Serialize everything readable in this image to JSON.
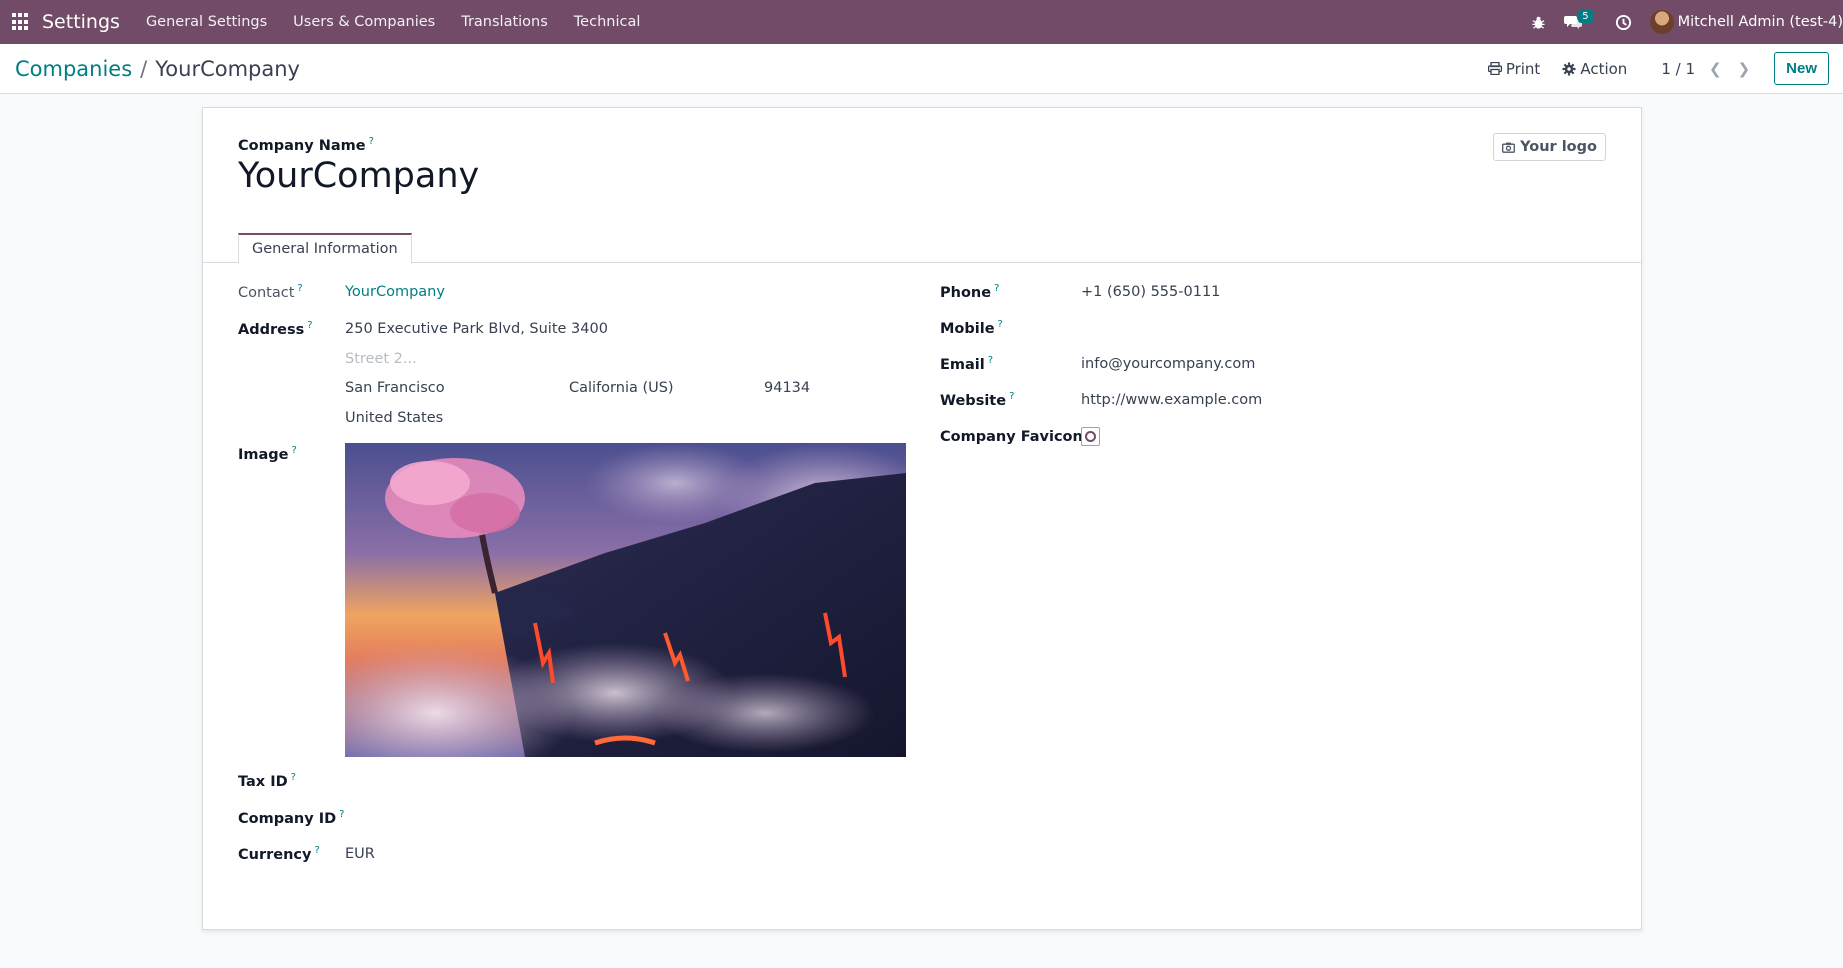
{
  "navbar": {
    "app_name": "Settings",
    "menu": [
      "General Settings",
      "Users & Companies",
      "Translations",
      "Technical"
    ],
    "messages_count": "5",
    "user_name": "Mitchell Admin (test-4)"
  },
  "control_panel": {
    "breadcrumb_parent": "Companies",
    "breadcrumb_separator": "/",
    "breadcrumb_current": "YourCompany",
    "print_label": "Print",
    "action_label": "Action",
    "pager": "1 / 1",
    "new_label": "New"
  },
  "form": {
    "company_name_label": "Company Name",
    "company_name": "YourCompany",
    "logo_button": "Your logo",
    "tab_general": "General Information",
    "help_marker": "?",
    "contact_label": "Contact",
    "contact_value": "YourCompany",
    "address_label": "Address",
    "street": "250 Executive Park Blvd, Suite 3400",
    "street2_placeholder": "Street 2...",
    "city": "San Francisco",
    "state": "California (US)",
    "zip": "94134",
    "country": "United States",
    "image_label": "Image",
    "tax_id_label": "Tax ID",
    "company_id_label": "Company ID",
    "currency_label": "Currency",
    "currency_value": "EUR",
    "phone_label": "Phone",
    "phone_value": "+1 (650) 555-0111",
    "mobile_label": "Mobile",
    "email_label": "Email",
    "email_value": "info@yourcompany.com",
    "website_label": "Website",
    "website_value": "http://www.example.com",
    "favicon_label": "Company Favicon"
  },
  "colors": {
    "navbar": "#714b67",
    "accent": "#017e84",
    "background": "#f9fafb"
  }
}
